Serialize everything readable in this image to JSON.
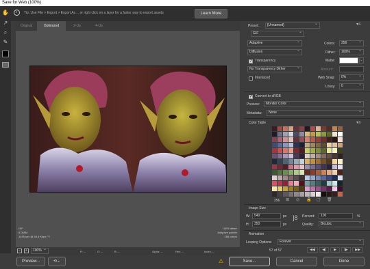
{
  "window": {
    "title": "Save for Web (100%)"
  },
  "tip": {
    "text": "Tip: Use File > Export > Export As…  or right click on a layer for a faster way to export assets",
    "learn_more": "Learn More"
  },
  "tabs": [
    "Original",
    "Optimized",
    "2-Up",
    "4-Up"
  ],
  "status": {
    "left_format": "GIF",
    "left_size": "8.065M",
    "left_time": "1495 sec @ 56.6 Kbps",
    "left_menu": "⁼≡",
    "right_dither": "100% dither",
    "right_palette": "Adaptive palette",
    "right_colors": "256 colors"
  },
  "bottom_bar": {
    "zoom": "100%",
    "r_label": "R: --",
    "g_label": "G: --",
    "b_label": "B: --",
    "alpha_label": "Alpha: --",
    "hex_label": "Hex: --",
    "index_label": "Index: --"
  },
  "footer": {
    "preview": "Preview...",
    "save": "Save...",
    "cancel": "Cancel",
    "done": "Done"
  },
  "settings": {
    "preset_label": "Preset:",
    "preset_value": "[Unnamed]",
    "format": "GIF",
    "reduction": "Adaptive",
    "colors_label": "Colors:",
    "colors_value": "256",
    "dither_algo": "Diffusion",
    "dither_label": "Dither:",
    "dither_value": "100%",
    "transparency_label": "Transparency",
    "matte_label": "Matte:",
    "transparency_dither": "No Transparency Dither",
    "amount_label": "Amount:",
    "interlaced_label": "Interlaced",
    "websnap_label": "Web Snap:",
    "websnap_value": "0%",
    "lossy_label": "Lossy:",
    "lossy_value": "0",
    "convert_srgb": "Convert to sRGB",
    "preview_label": "Preview:",
    "preview_value": "Monitor Color",
    "metadata_label": "Metadata:",
    "metadata_value": "None"
  },
  "color_table": {
    "title": "Color Table",
    "count": "256",
    "colors": [
      "#3d1a24",
      "#a5463e",
      "#c86f56",
      "#d9a07a",
      "#6b2d35",
      "#8a3e48",
      "#2b1620",
      "#b04a4e",
      "#e6b18f",
      "#7c3a2a",
      "#5d2a1f",
      "#c4834d",
      "#9c5d3a",
      "#1f1a2c",
      "#6a6f8c",
      "#a39fb8",
      "#d8d5e2",
      "#4c4a66",
      "#8d8aa6",
      "#e2b96b",
      "#c79a3f",
      "#b7c24a",
      "#8e9c2e",
      "#5e6a1f",
      "#f0e4cc",
      "#ffffff",
      "#8c3f52",
      "#b45f72",
      "#d98e94",
      "#e9c0b9",
      "#6a2e3c",
      "#9b4957",
      "#e07c6c",
      "#c25640",
      "#9e3a2e",
      "#7a2a22",
      "#4a1c18",
      "#2b120f",
      "#fae0d0",
      "#3e4a7a",
      "#5b6aa0",
      "#8896c4",
      "#b7c0de",
      "#2a3258",
      "#1a1f3c",
      "#c6a97b",
      "#a5865a",
      "#83683f",
      "#5f4a2c",
      "#f2d2a4",
      "#e6c29a",
      "#d1a27a",
      "#b72c3a",
      "#d94a4a",
      "#e67062",
      "#f29b80",
      "#8e1f2c",
      "#5e1620",
      "#c9d14f",
      "#a6b13a",
      "#82902b",
      "#5f6a20",
      "#e8ec8a",
      "#f7f4b4",
      "#3d4418",
      "#6d4f7a",
      "#8d6c9c",
      "#b093be",
      "#d2bcdc",
      "#4e355a",
      "#2e1f36",
      "#e2d2c6",
      "#c7b0a2",
      "#a88c7e",
      "#876a5e",
      "#6a4e44",
      "#4c362e",
      "#33221c",
      "#1c2a38",
      "#2f4456",
      "#4a6478",
      "#6f8a9c",
      "#98b0be",
      "#c0d2da",
      "#e0b050",
      "#c89030",
      "#a87020",
      "#805018",
      "#5a3810",
      "#f8d890",
      "#fff0c0",
      "#a0324a",
      "#7c2438",
      "#5a1a28",
      "#d07088",
      "#e898a8",
      "#f4c0c8",
      "#9a8cb0",
      "#7a6c94",
      "#5c4e78",
      "#403458",
      "#2a2040",
      "#c8bcd8",
      "#e8e0f0",
      "#3a5a2a",
      "#4e7438",
      "#6a9048",
      "#8aae60",
      "#b0cc80",
      "#d6e6a8",
      "#702818",
      "#943a20",
      "#b85a30",
      "#d88048",
      "#ecaa70",
      "#f6cca0",
      "#542010",
      "#ddd0d0",
      "#c0a8a8",
      "#a08888",
      "#806868",
      "#604c4c",
      "#403030",
      "#b8c8e8",
      "#98a8d0",
      "#7888b8",
      "#5868a0",
      "#384888",
      "#1c2c60",
      "#d8e0f8",
      "#e84860",
      "#c83048",
      "#a01c34",
      "#f07890",
      "#f8a8b8",
      "#600c1c",
      "#70a0a0",
      "#508080",
      "#346060",
      "#1c4040",
      "#98c8c8",
      "#c8e8e8",
      "#0c2828",
      "#f8e8a0",
      "#e8c860",
      "#c8a030",
      "#a07c18",
      "#786010",
      "#504008",
      "#e098d0",
      "#c070b0",
      "#a05090",
      "#803070",
      "#601850",
      "#f8c8e8",
      "#400c34",
      "#302828",
      "#484040",
      "#605858",
      "#787070",
      "#908888",
      "#a8a0a0",
      "#c0b8b8",
      "#d8d0d0",
      "#f0e8e8",
      "#181010",
      "#281818",
      "#382020",
      "#d06040"
    ]
  },
  "image_size": {
    "title": "Image Size",
    "w_label": "W:",
    "w_value": "540",
    "h_label": "H:",
    "h_value": "350",
    "px": "px",
    "percent_label": "Percent:",
    "percent_value": "100",
    "percent_unit": "%",
    "quality_label": "Quality:",
    "quality_value": "Bicubic"
  },
  "animation": {
    "title": "Animation",
    "looping_label": "Looping Options:",
    "looping_value": "Forever",
    "frame_counter": "57 of 57"
  },
  "accent_colors": {
    "warning": "#f1b900",
    "panel": "#3c3c3c",
    "preview_bg": "#505050"
  }
}
